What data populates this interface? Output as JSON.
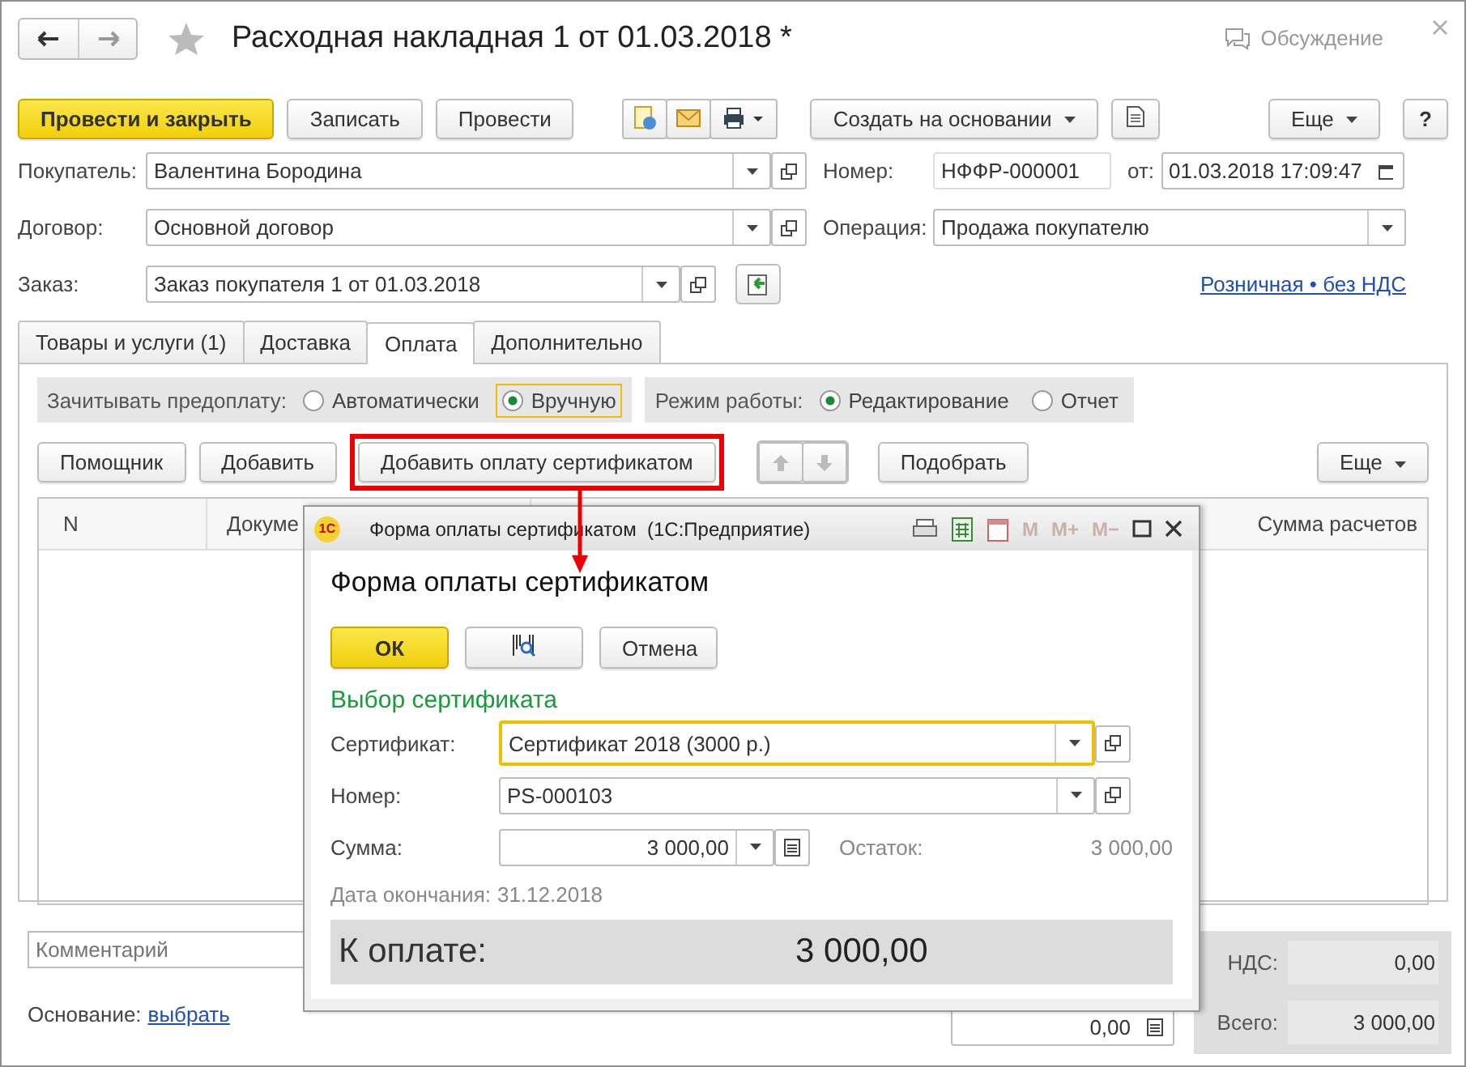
{
  "window": {
    "title": "Расходная накладная 1 от 01.03.2018 *",
    "discussion": "Обсуждение"
  },
  "toolbar": {
    "buttons": [
      {
        "label": "Провести и закрыть",
        "kind": "primary"
      },
      {
        "label": "Записать",
        "kind": "normal"
      },
      {
        "label": "Провести",
        "kind": "normal"
      }
    ],
    "create_based": "Создать на основании",
    "more": "Еще",
    "help": "?"
  },
  "fields": [
    {
      "label": "Покупатель:",
      "value": "Валентина Бородина"
    },
    {
      "label": "Договор:",
      "value": "Основной договор"
    },
    {
      "label": "Заказ:",
      "value": "Заказ покупателя 1 от 01.03.2018"
    }
  ],
  "number": {
    "label": "Номер:",
    "value": "НФФР-000001",
    "date_label": "от:",
    "date": "01.03.2018 17:09:47"
  },
  "operation": {
    "label": "Операция:",
    "value": "Продажа покупателю"
  },
  "price_link": "Розничная • без НДС",
  "tabs": [
    {
      "label": "Товары и услуги (1)",
      "selected": false
    },
    {
      "label": "Доставка",
      "selected": false
    },
    {
      "label": "Оплата",
      "selected": true
    },
    {
      "label": "Дополнительно",
      "selected": false
    }
  ],
  "prepayment": {
    "label": "Зачитывать предоплату:",
    "options": [
      {
        "label": "Автоматически",
        "selected": false
      },
      {
        "label": "Вручную",
        "selected": true
      }
    ]
  },
  "mode": {
    "label": "Режим работы:",
    "options": [
      {
        "label": "Редактирование",
        "selected": true
      },
      {
        "label": "Отчет",
        "selected": false
      }
    ]
  },
  "table_toolbar": {
    "buttons": [
      {
        "label": "Помощник",
        "highlighted": false
      },
      {
        "label": "Добавить",
        "highlighted": false
      },
      {
        "label": "Добавить оплату сертификатом",
        "highlighted": true
      }
    ],
    "pick": "Подобрать",
    "more": "Еще"
  },
  "table": {
    "columns": [
      "N",
      "Докуме",
      "Сумма расчетов"
    ]
  },
  "footer": {
    "comment_placeholder": "Комментарий",
    "basis_label": "Основание:",
    "basis_link": "выбрать",
    "amount": "0,00",
    "totals": [
      {
        "label": "НДС:",
        "value": "0,00"
      },
      {
        "label": "Всего:",
        "value": "3 000,00"
      }
    ]
  },
  "dialog": {
    "logo": "1С",
    "title": "Форма оплаты сертификатом  (1С:Предприятие)",
    "memory_buttons": [
      "M",
      "M+",
      "M−"
    ],
    "heading": "Форма оплаты сертификатом",
    "ok": "ОК",
    "cancel": "Отмена",
    "section": "Выбор сертификата",
    "certificate": {
      "label": "Сертификат:",
      "value": "Сертификат 2018 (3000 р.)",
      "focused": true
    },
    "number": {
      "label": "Номер:",
      "value": "PS-000103",
      "focused": false
    },
    "sum": {
      "label": "Сумма:",
      "value": "3 000,00"
    },
    "remainder": {
      "label": "Остаток:",
      "value": "3 000,00"
    },
    "end_date": {
      "label": "Дата окончания:",
      "value": "31.12.2018"
    },
    "to_pay": {
      "label": "К оплате:",
      "value": "3 000,00"
    }
  }
}
